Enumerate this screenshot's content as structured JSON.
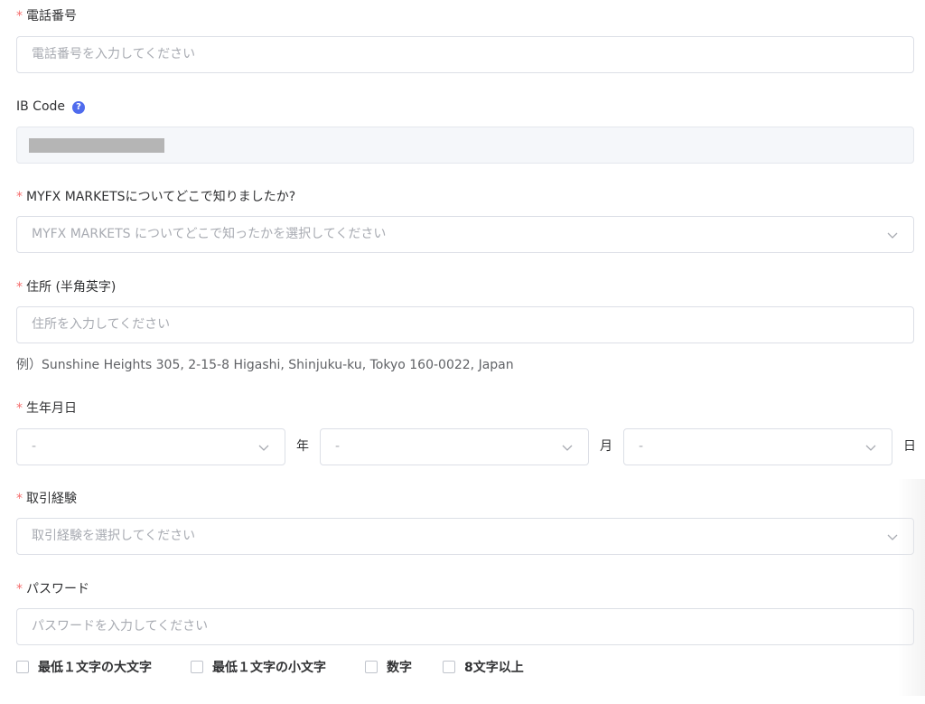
{
  "fields": {
    "phone": {
      "required_mark": "*",
      "label": "電話番号",
      "placeholder": "電話番号を入力してください"
    },
    "ib_code": {
      "label": "IB Code",
      "help_icon": "question-circle-icon",
      "help_glyph": "?"
    },
    "referral": {
      "required_mark": "*",
      "label": "MYFX MARKETSについてどこで知りましたか?",
      "placeholder": "MYFX MARKETS についてどこで知ったかを選択してください"
    },
    "address": {
      "required_mark": "*",
      "label": "住所 (半角英字)",
      "placeholder": "住所を入力してください",
      "hint": "例）Sunshine Heights 305, 2-15-8 Higashi, Shinjuku-ku, Tokyo 160-0022, Japan"
    },
    "birthdate": {
      "required_mark": "*",
      "label": "生年月日",
      "year_value": "-",
      "year_unit": "年",
      "month_value": "-",
      "month_unit": "月",
      "day_value": "-",
      "day_unit": "日"
    },
    "experience": {
      "required_mark": "*",
      "label": "取引経験",
      "placeholder": "取引経験を選択してください"
    },
    "password": {
      "required_mark": "*",
      "label": "パスワード",
      "placeholder": "パスワードを入力してください",
      "rules": [
        {
          "label": "最低１文字の大文字",
          "checked": false
        },
        {
          "label": "最低１文字の小文字",
          "checked": false
        },
        {
          "label": "数字",
          "checked": false
        },
        {
          "label": "8文字以上",
          "checked": false
        }
      ]
    }
  },
  "colors": {
    "required": "#f56c6c",
    "help_icon": "#4f6bed",
    "border": "#dcdfe6",
    "placeholder": "#a8abb2",
    "disabled_bg": "#f5f7fa"
  }
}
